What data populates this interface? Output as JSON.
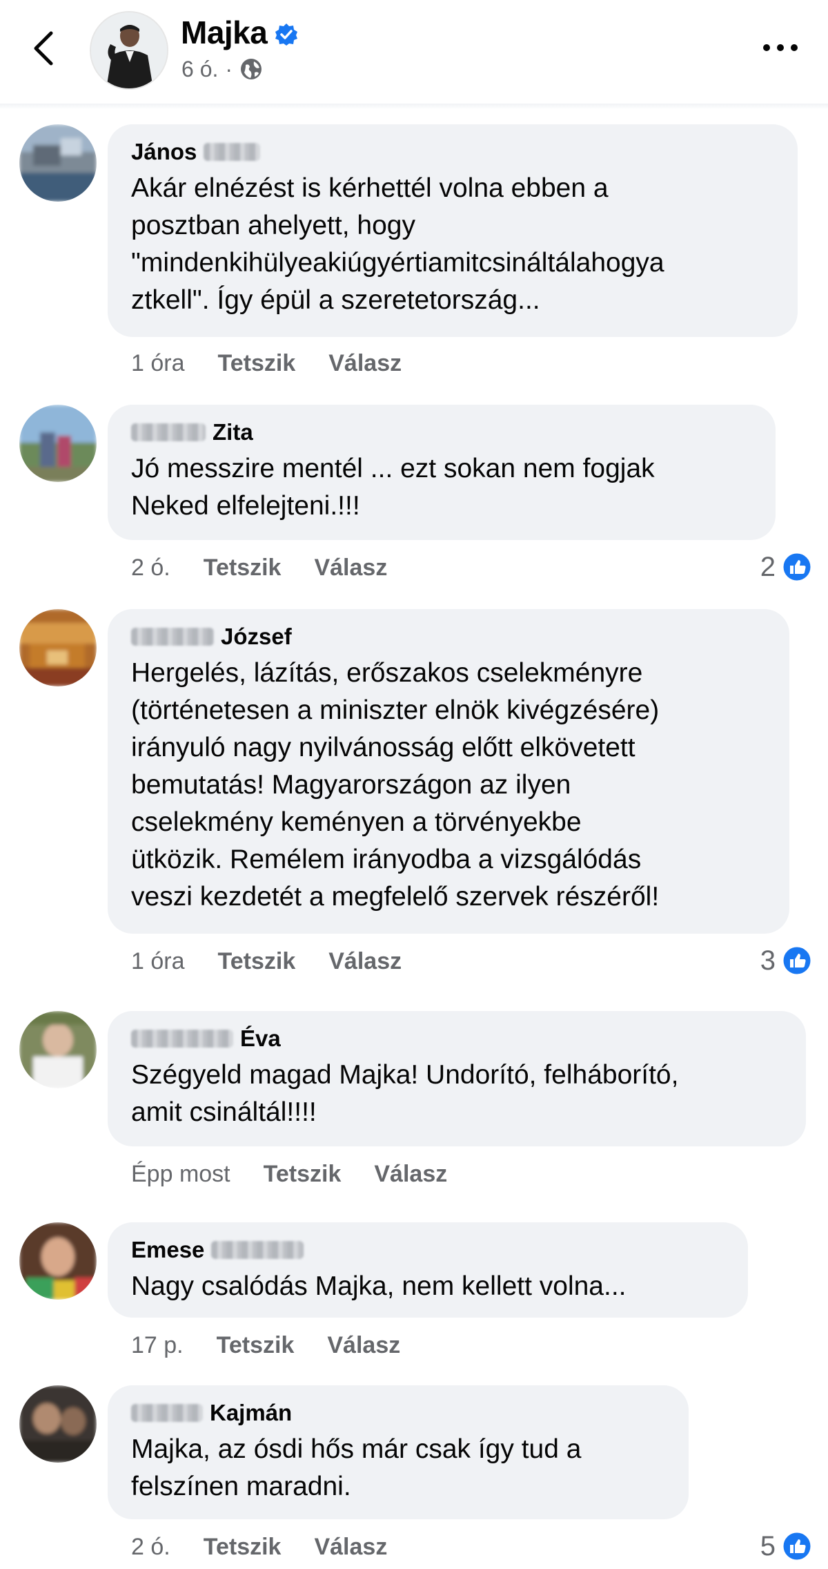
{
  "header": {
    "name": "Majka",
    "meta_time": "6 ó.",
    "meta_dot": "·",
    "back_icon": "chevron-left-icon",
    "verified_icon": "verified-badge-icon",
    "globe_icon": "globe-icon",
    "more_icon": "more-horizontal-icon"
  },
  "colors": {
    "accent": "#1877f2",
    "bubble": "#f0f2f5",
    "secondary_text": "#65676b"
  },
  "comments": [
    {
      "first": "János",
      "name_order": "first-blurred-last",
      "text": "Akár elnézést is kérhettél volna ebben a\nposztban ahelyett, hogy\n\"mindenkihülyeakiúgyértiamitcsináltálahogya\nztkell\". Így épül a szeretetország...",
      "time": "1 óra",
      "like": "Tetszik",
      "reply": "Válasz",
      "reactions": ""
    },
    {
      "first": "Zita",
      "name_order": "blurred-first",
      "text": "Jó messzire mentél ... ezt sokan nem fogjak\nNeked elfelejteni.!!!",
      "time": "2 ó.",
      "like": "Tetszik",
      "reply": "Válasz",
      "reactions": "2"
    },
    {
      "first": "József",
      "name_order": "blurred-first",
      "text": "Hergelés, lázítás, erőszakos cselekményre\n(történetesen a miniszter elnök kivégzésére)\nirányuló nagy nyilvánosság előtt elkövetett\nbemutatás! Magyarországon az ilyen\ncselekmény keményen a törvényekbe\nütközik. Remélem irányodba a vizsgálódás\nveszi kezdetét a megfelelő szervek részéről!",
      "time": "1 óra",
      "like": "Tetszik",
      "reply": "Válasz",
      "reactions": "3"
    },
    {
      "first": "Éva",
      "name_order": "blurred-first",
      "text": "Szégyeld magad Majka! Undorító, felháborító,\namit csináltál!!!!",
      "time": "Épp most",
      "like": "Tetszik",
      "reply": "Válasz",
      "reactions": ""
    },
    {
      "first": "Emese",
      "name_order": "first-blurred-last",
      "text": "Nagy csalódás Majka, nem kellett volna...",
      "time": "17 p.",
      "like": "Tetszik",
      "reply": "Válasz",
      "reactions": ""
    },
    {
      "first": "Kajmán",
      "name_order": "blurred-first",
      "text": "Majka, az ósdi hős már csak így tud a\nfelszínen maradni.",
      "time": "2 ó.",
      "like": "Tetszik",
      "reply": "Válasz",
      "reactions": "5"
    }
  ]
}
